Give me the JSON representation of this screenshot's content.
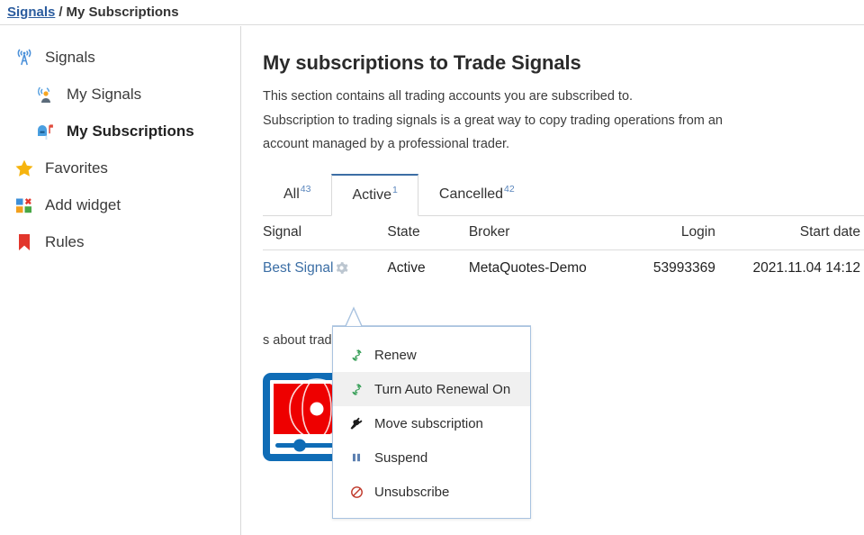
{
  "breadcrumb": {
    "link": "Signals",
    "separator": "/",
    "current": "My Subscriptions"
  },
  "sidebar": {
    "items": [
      {
        "label": "Signals",
        "icon": "broadcast-tower-icon",
        "level": 1,
        "selected": false
      },
      {
        "label": "My Signals",
        "icon": "signal-person-icon",
        "level": 2,
        "selected": false
      },
      {
        "label": "My Subscriptions",
        "icon": "mailbox-icon",
        "level": 2,
        "selected": true
      },
      {
        "label": "Favorites",
        "icon": "star-icon",
        "level": 1,
        "selected": false
      },
      {
        "label": "Add widget",
        "icon": "add-widget-icon",
        "level": 1,
        "selected": false
      },
      {
        "label": "Rules",
        "icon": "bookmark-icon",
        "level": 1,
        "selected": false
      }
    ]
  },
  "main": {
    "title": "My subscriptions to Trade Signals",
    "intro_line1": "This section contains all trading accounts you are subscribed to.",
    "intro_line2": "Subscription to trading signals is a great way to copy trading operations from an",
    "intro_line3": "account managed by a professional trader.",
    "tabs": [
      {
        "label": "All",
        "count": "43",
        "active": false
      },
      {
        "label": "Active",
        "count": "1",
        "active": true
      },
      {
        "label": "Cancelled",
        "count": "42",
        "active": false
      }
    ],
    "table": {
      "columns": [
        "Signal",
        "State",
        "Broker",
        "Login",
        "Start date"
      ],
      "rows": [
        {
          "signal": "Best Signal",
          "state": "Active",
          "broker": "MetaQuotes-Demo",
          "login": "53993369",
          "start_date": "2021.11.04 14:12"
        }
      ]
    },
    "promo": {
      "text": "s about trading signals on YouTube",
      "video_icon": "video-player-icon"
    }
  },
  "context_menu": {
    "items": [
      {
        "label": "Renew",
        "icon": "renew-icon",
        "highlighted": false
      },
      {
        "label": "Turn Auto Renewal On",
        "icon": "renew-icon",
        "highlighted": true
      },
      {
        "label": "Move subscription",
        "icon": "plug-icon",
        "highlighted": false
      },
      {
        "label": "Suspend",
        "icon": "pause-icon",
        "highlighted": false
      },
      {
        "label": "Unsubscribe",
        "icon": "prohibition-icon",
        "highlighted": false
      }
    ]
  },
  "colors": {
    "link": "#3b6ea5",
    "accent_tab": "#3c6ea5",
    "renew_green": "#3aa05a",
    "pause_blue": "#5b7fb0",
    "unsubscribe_red": "#c0392b",
    "video_blue": "#0f6cb6",
    "video_red": "#ee0000"
  }
}
